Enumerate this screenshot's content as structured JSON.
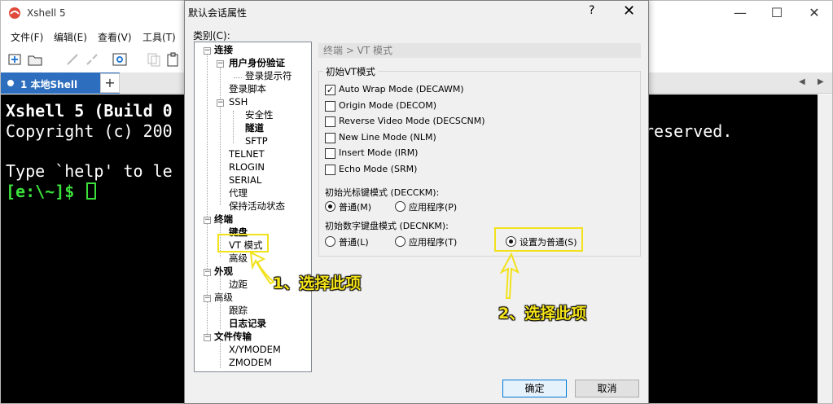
{
  "app": {
    "title": "Xshell 5",
    "window_controls": {
      "minimize": "—",
      "maximize": "☐",
      "close": "✕"
    },
    "menu": [
      "文件(F)",
      "编辑(E)",
      "查看(V)",
      "工具(T)"
    ],
    "toolbar_icons": [
      "new-session-icon",
      "open-folder-icon",
      "connect-icon",
      "disconnect-icon",
      "properties-icon",
      "copy-icon",
      "paste-icon"
    ],
    "tab": {
      "label": "1 本地Shell",
      "close": "×",
      "add": "+",
      "nav_left": "◀",
      "nav_right": "▶"
    },
    "terminal": {
      "line1": "Xshell 5 (Build 0",
      "line2": "Copyright (c) 200",
      "line2_right": "reserved.",
      "line3": "Type `help' to le",
      "prompt": "[e:\\~]$ "
    }
  },
  "dialog": {
    "title": "默认会话属性",
    "help": "?",
    "close": "✕",
    "category_label": "类别(C):",
    "tree": {
      "connection": "连接",
      "auth": "用户身份验证",
      "login_prompt": "登录提示符",
      "login_script": "登录脚本",
      "ssh": "SSH",
      "security": "安全性",
      "tunnel": "隧道",
      "sftp": "SFTP",
      "telnet": "TELNET",
      "rlogin": "RLOGIN",
      "serial": "SERIAL",
      "proxy": "代理",
      "keepalive": "保持活动状态",
      "terminal": "终端",
      "keyboard": "键盘",
      "vt_mode": "VT 模式",
      "advanced": "高级",
      "appearance": "外观",
      "margin": "边距",
      "advanced2": "高级",
      "trace": "跟踪",
      "logging": "日志记录",
      "file_transfer": "文件传输",
      "xymodem": "X/YMODEM",
      "zmodem": "ZMODEM"
    },
    "breadcrumb": "终端 > VT 模式",
    "group_title": "初始VT模式",
    "checkboxes": [
      {
        "label": "Auto Wrap Mode (DECAWM)",
        "checked": true
      },
      {
        "label": "Origin Mode (DECOM)",
        "checked": false
      },
      {
        "label": "Reverse Video Mode (DECSCNM)",
        "checked": false
      },
      {
        "label": "New Line Mode (NLM)",
        "checked": false
      },
      {
        "label": "Insert Mode (IRM)",
        "checked": false
      },
      {
        "label": "Echo Mode (SRM)",
        "checked": false
      }
    ],
    "cursor_keys": {
      "label": "初始光标键模式 (DECCKM):",
      "normal": "普通(M)",
      "application": "应用程序(P)",
      "selected": "normal"
    },
    "numpad": {
      "label": "初始数字键盘模式 (DECNKM):",
      "normal": "普通(L)",
      "application": "应用程序(T)",
      "force_normal": "设置为普通(S)",
      "selected": "force_normal"
    },
    "ok": "确定",
    "cancel": "取消"
  },
  "annotations": {
    "step1": "1、选择此项",
    "step2": "2、选择此项",
    "color": "#f2e21c"
  }
}
